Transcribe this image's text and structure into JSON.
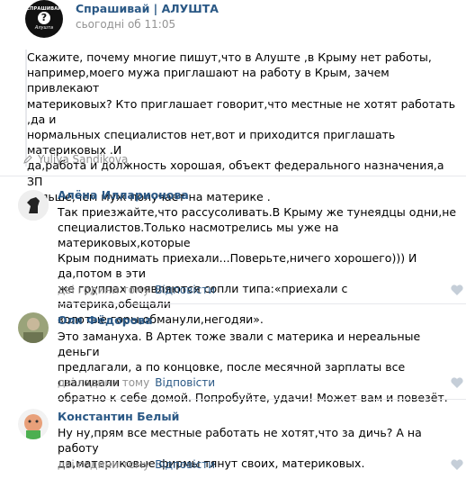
{
  "post": {
    "group_name": "Спрашивай | АЛУШТА",
    "time": "сьогодні об 11:05",
    "avatar_top": "СПРАШИВАЙ",
    "avatar_mark": "?",
    "avatar_bottom": "Алушта",
    "text": "Скажите, почему многие пишут,что в Алуште ,в Крыму нет работы,\nнапример,моего мужа приглашают на работу в Крым, зачем привлекают\nматериковых? Кто приглашает говорит,что местные не хотят работать ,да и\nнормальных специалистов нет,вот и приходится приглашать материковых .И\nда,работа и должность хорошая, объект федерального назначения,а ЗП\nбольше,чем муж получает на материке .",
    "author": "Yuliya Sandikova"
  },
  "comments": [
    {
      "name": "Алёна Илларионова",
      "text": "Так приезжайте,что рассусоливать.В Крыму же тунеядцы одни,не\nспециалистов.Только насмотрелись мы уже на материковых,которые\nКрым поднимать приехали...Поверьте,ничего хорошего))) И да,потом в эти\nже группах появляются сопли типа:«приехали с материка,обещали\nзолотые горы,обманули,негодяи».",
      "time": "дві години тому",
      "reply": "Відповісти"
    },
    {
      "name": "Оля Фёдорова",
      "text": "Это замануха. В Артек тоже звали с материка и нереальные деньги\nпредлагали, а по концовке, после месячной зарплаты все сваливали\nобратно к себе домой. Попробуйте, удачи! Может вам и повезёт.",
      "time": "дві години тому",
      "reply": "Відповісти"
    },
    {
      "name": "Константин Белый",
      "text": "Ну ну,прям все местные работать не хотят,что за дичь? А на работу\nда,материковые фирмы тянут своих, материковых.",
      "time": "дві години тому",
      "reply": "Відповісти"
    }
  ],
  "colors": {
    "link": "#2a5885",
    "meta": "#939393",
    "divider": "#e7e8ec"
  },
  "icons": [
    "pen-icon",
    "like-icon"
  ]
}
